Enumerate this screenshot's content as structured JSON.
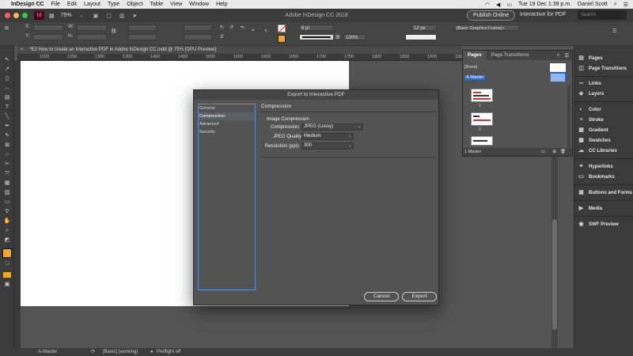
{
  "menubar": {
    "app": "InDesign CC",
    "items": [
      "File",
      "Edit",
      "Layout",
      "Type",
      "Object",
      "Table",
      "View",
      "Window",
      "Help"
    ],
    "clock": "Tue 19 Dec  1:39 p.m.",
    "user": "Daniel Scott"
  },
  "appbar": {
    "logo": "Id",
    "zoom": "75%",
    "title": "Adobe InDesign CC 2018",
    "publish_label": "Publish Online",
    "workspace": "Interactive for PDF",
    "search_placeholder": "Search"
  },
  "control": {
    "stroke_weight": "6 pt",
    "opacity": "100%",
    "fx_value": "12 px",
    "object_style": "[Basic Graphics Frame]+"
  },
  "document": {
    "tab_label": "*E2 How to create an Interactive PDF in Adobe InDesign CC.indd @ 75% [GPU Preview]",
    "ruler_ticks": [
      "1200",
      "1250",
      "1300",
      "1350",
      "1400",
      "1450",
      "1500",
      "1550",
      "1600",
      "1650",
      "1700",
      "1750",
      "1800",
      "1850",
      "1900",
      "1950",
      "2000",
      "2050",
      "2100"
    ]
  },
  "statusbar": {
    "page": "A-Master",
    "style": "[Basic] (working)",
    "preflight": "Preflight off"
  },
  "pages_panel": {
    "tabs": [
      "Pages",
      "Page Transitions"
    ],
    "none_label": "[None]",
    "master_label": "A-Master",
    "page_numbers": [
      "1",
      "2"
    ],
    "footer": "1 Master"
  },
  "right_panel": {
    "items": [
      "Pages",
      "Page Transitions",
      "Links",
      "Layers",
      "Color",
      "Stroke",
      "Gradient",
      "Swatches",
      "CC Libraries",
      "Hyperlinks",
      "Bookmarks",
      "Buttons and Forms",
      "Media",
      "SWF Preview"
    ]
  },
  "dialog": {
    "title": "Export to Interactive PDF",
    "categories": [
      "General",
      "Compression",
      "Advanced",
      "Security"
    ],
    "selected_category": "Compression",
    "section_title": "Compression",
    "image_compression_heading": "Image Compression",
    "compression_label": "Compression:",
    "compression_value": "JPEG (Lossy)",
    "jpeg_quality_label": "JPEG Quality:",
    "jpeg_quality_value": "Medium",
    "resolution_label": "Resolution (ppi):",
    "resolution_value": "300",
    "cancel_label": "Cancel",
    "export_label": "Export"
  }
}
